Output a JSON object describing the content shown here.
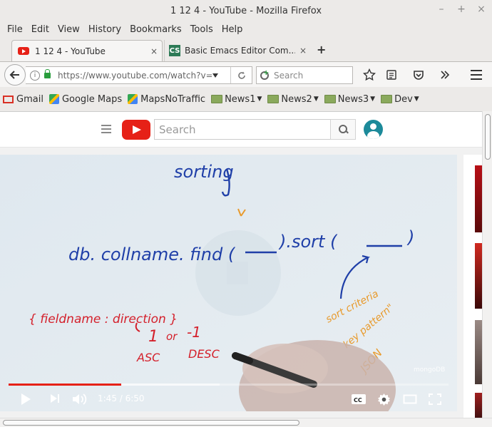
{
  "window": {
    "title": "1 12 4 - YouTube - Mozilla Firefox",
    "controls": [
      "–",
      "+",
      "×"
    ]
  },
  "menu": [
    "File",
    "Edit",
    "View",
    "History",
    "Bookmarks",
    "Tools",
    "Help"
  ],
  "tabs": [
    {
      "label": "1 12 4 - YouTube",
      "icon": "youtube-favicon",
      "close": "×"
    },
    {
      "label": "Basic Emacs Editor Com...",
      "icon": "cs-favicon",
      "favicon_text": "CS",
      "close": "×"
    }
  ],
  "newtab": "+",
  "nav": {
    "url": "https://www.youtube.com/watch?v=Ez",
    "search_placeholder": "Search",
    "info_glyph": "i"
  },
  "bookmarks": [
    {
      "label": "Gmail",
      "icon": "gmail-icon",
      "dropdown": false
    },
    {
      "label": "Google Maps",
      "icon": "maps-icon",
      "dropdown": false
    },
    {
      "label": "MapsNoTraffic",
      "icon": "maps-icon",
      "dropdown": false
    },
    {
      "label": "News1",
      "icon": "folder-icon",
      "dropdown": true
    },
    {
      "label": "News2",
      "icon": "folder-icon",
      "dropdown": true
    },
    {
      "label": "News3",
      "icon": "folder-icon",
      "dropdown": true
    },
    {
      "label": "Dev",
      "icon": "folder-icon",
      "dropdown": true
    }
  ],
  "youtube": {
    "search_placeholder": "Search"
  },
  "video": {
    "whiteboard": {
      "heading": "sorting",
      "command": "db. collname. find (",
      "command_end": ").sort (",
      "close_paren": ")",
      "field_expr": "{ fieldname : direction }",
      "one": "1",
      "or": "or",
      "minus_one": "-1",
      "asc": "ASC",
      "desc": "DESC",
      "note_criteria": "sort criteria",
      "note_key": "key pattern\"",
      "note_json": "JSON"
    },
    "watermark": "mongoDB",
    "current_time": "1:45",
    "duration": "6:50",
    "time_display": "1:45 / 6:50",
    "played_fraction": 0.256,
    "loaded_fraction": 0.48,
    "colors": {
      "played": "#e62117",
      "blue_ink": "#1f3fa8",
      "red_ink": "#d4202b",
      "orange_ink": "#e89a2c"
    }
  }
}
